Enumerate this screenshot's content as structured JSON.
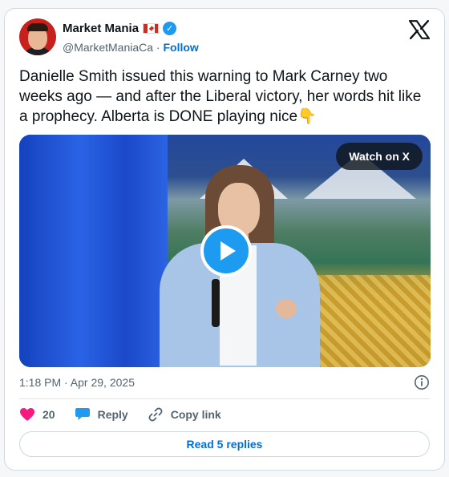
{
  "author": {
    "display_name": "Market Mania",
    "handle": "@MarketManiaCa",
    "separator": "·",
    "follow_label": "Follow",
    "flag": "canada-flag-icon",
    "verified_badge": "verified-icon"
  },
  "tweet": {
    "text": "Danielle Smith issued this warning to Mark Carney two weeks ago — and after the Liberal victory, her words hit like a prophecy. Alberta is DONE playing nice",
    "emoji": "👇",
    "timestamp": "1:18 PM · Apr 29, 2025"
  },
  "media": {
    "watch_label": "Watch on X",
    "play_icon": "play-icon"
  },
  "actions": {
    "like_count": "20",
    "reply_label": "Reply",
    "copy_link_label": "Copy link"
  },
  "footer": {
    "read_replies_label": "Read 5 replies"
  },
  "colors": {
    "accent": "#1d9bf0",
    "link": "#006fd6",
    "like": "#f91880",
    "muted": "#536471"
  }
}
